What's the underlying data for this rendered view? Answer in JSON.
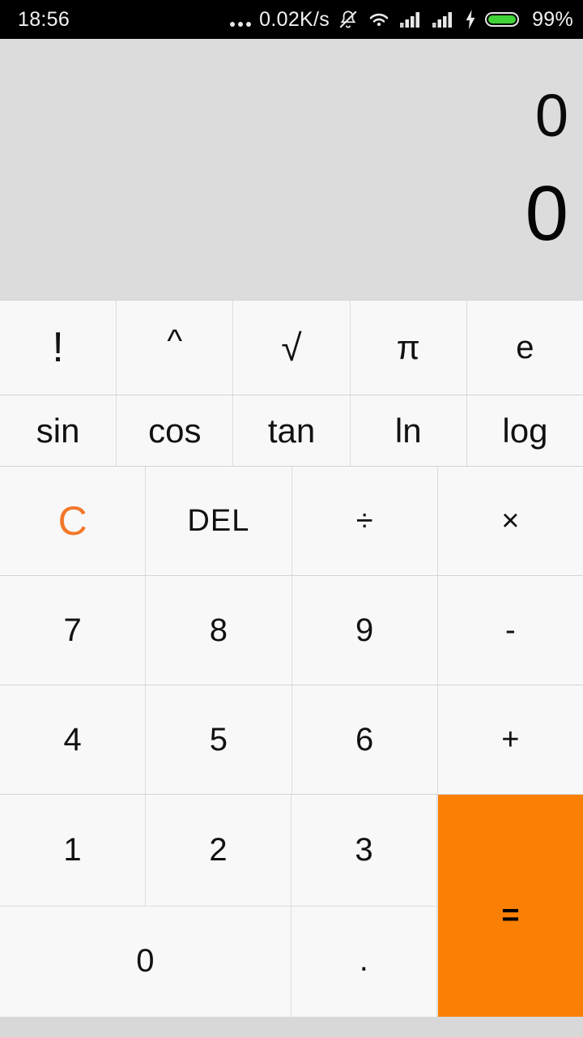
{
  "statusbar": {
    "time": "18:56",
    "net_speed": "0.02K/s",
    "battery_text": "99%",
    "icons": [
      "dots-icon",
      "mute-bell-icon",
      "wifi-icon",
      "signal-bars-icon",
      "signal-bars-2-icon",
      "charging-bolt-icon",
      "battery-icon"
    ],
    "battery_color": "#3fd335"
  },
  "display": {
    "expression": "0",
    "result": "0",
    "background": "#dcdcdc"
  },
  "keypad": {
    "accent_color": "#f57c20",
    "equals_bg": "#fa8005",
    "row_functions_1": [
      {
        "label": "!",
        "name": "factorial"
      },
      {
        "label": "^",
        "name": "power"
      },
      {
        "label": "√",
        "name": "square-root"
      },
      {
        "label": "π",
        "name": "pi"
      },
      {
        "label": "e",
        "name": "euler"
      }
    ],
    "row_functions_2": [
      {
        "label": "sin",
        "name": "sin"
      },
      {
        "label": "cos",
        "name": "cos"
      },
      {
        "label": "tan",
        "name": "tan"
      },
      {
        "label": "ln",
        "name": "ln"
      },
      {
        "label": "log",
        "name": "log"
      }
    ],
    "row_clear": [
      {
        "label": "C",
        "name": "clear"
      },
      {
        "label": "DEL",
        "name": "delete"
      },
      {
        "label": "÷",
        "name": "divide"
      },
      {
        "label": "×",
        "name": "multiply"
      }
    ],
    "row_789": [
      {
        "label": "7",
        "name": "7"
      },
      {
        "label": "8",
        "name": "8"
      },
      {
        "label": "9",
        "name": "9"
      },
      {
        "label": "-",
        "name": "minus"
      }
    ],
    "row_456": [
      {
        "label": "4",
        "name": "4"
      },
      {
        "label": "5",
        "name": "5"
      },
      {
        "label": "6",
        "name": "6"
      },
      {
        "label": "+",
        "name": "plus"
      }
    ],
    "row_123": [
      {
        "label": "1",
        "name": "1"
      },
      {
        "label": "2",
        "name": "2"
      },
      {
        "label": "3",
        "name": "3"
      }
    ],
    "row_zero": [
      {
        "label": "0",
        "name": "0"
      },
      {
        "label": ".",
        "name": "decimal-point"
      }
    ],
    "equals": {
      "label": "=",
      "name": "equals"
    }
  }
}
